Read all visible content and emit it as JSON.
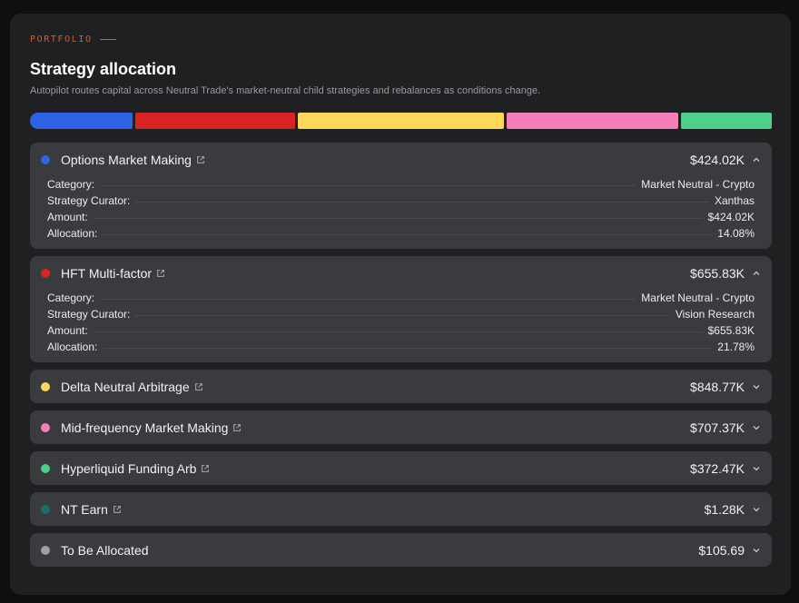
{
  "header": {
    "eyebrow": "PORTFOLIO",
    "title": "Strategy allocation",
    "subtitle": "Autopilot routes capital across Neutral Trade's market-neutral child strategies and rebalances as conditions change."
  },
  "colors": {
    "accent": "#e2552d",
    "options": "#2f63e6",
    "hft": "#d82424",
    "delta": "#fdd85a",
    "mid": "#f57fbb",
    "hyper": "#4fd08a",
    "ntearn": "#1a6e6b",
    "unallocated": "#9e9ea3"
  },
  "allocation_bar": [
    {
      "name": "Options Market Making",
      "value": 424.02,
      "color": "#2f63e6"
    },
    {
      "name": "HFT Multi-factor",
      "value": 655.83,
      "color": "#d82424"
    },
    {
      "name": "Delta Neutral Arbitrage",
      "value": 848.77,
      "color": "#fdd85a"
    },
    {
      "name": "Mid-frequency Market Making",
      "value": 707.37,
      "color": "#f57fbb"
    },
    {
      "name": "Hyperliquid Funding Arb",
      "value": 372.47,
      "color": "#4fd08a"
    }
  ],
  "detail_labels": {
    "category": "Category:",
    "curator": "Strategy Curator:",
    "amount": "Amount:",
    "allocation": "Allocation:"
  },
  "strategies": [
    {
      "name": "Options Market Making",
      "amount": "$424.02K",
      "expanded": true,
      "external": true,
      "category": "Market Neutral - Crypto",
      "curator": "Xanthas",
      "detail_amount": "$424.02K",
      "allocation": "14.08%"
    },
    {
      "name": "HFT Multi-factor",
      "amount": "$655.83K",
      "expanded": true,
      "external": true,
      "category": "Market Neutral - Crypto",
      "curator": "Vision Research",
      "detail_amount": "$655.83K",
      "allocation": "21.78%"
    },
    {
      "name": "Delta Neutral Arbitrage",
      "amount": "$848.77K",
      "expanded": false,
      "external": true
    },
    {
      "name": "Mid-frequency Market Making",
      "amount": "$707.37K",
      "expanded": false,
      "external": true
    },
    {
      "name": "Hyperliquid Funding Arb",
      "amount": "$372.47K",
      "expanded": false,
      "external": true
    },
    {
      "name": "NT Earn",
      "amount": "$1.28K",
      "expanded": false,
      "external": true
    },
    {
      "name": "To Be Allocated",
      "amount": "$105.69",
      "expanded": false,
      "external": false
    }
  ]
}
